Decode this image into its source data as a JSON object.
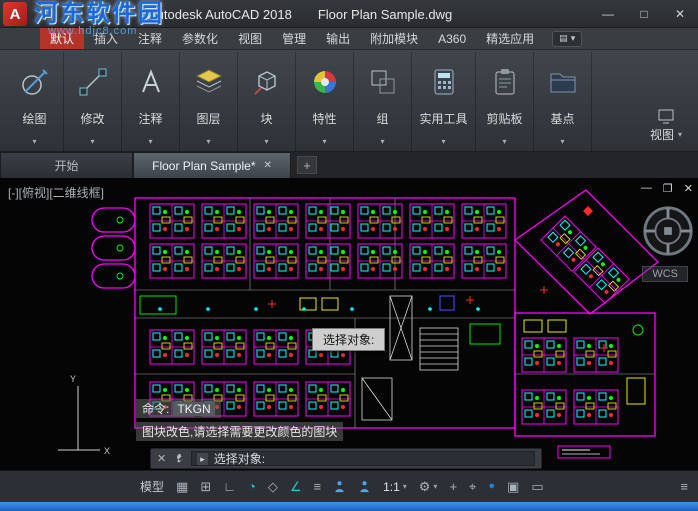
{
  "titlebar": {
    "app_title": "Autodesk AutoCAD 2018",
    "doc_title": "Floor Plan Sample.dwg",
    "logo_letter": "A",
    "minimize": "—",
    "maximize": "□",
    "close": "✕"
  },
  "watermark": {
    "title": "河东软件园",
    "url": "www.hdjc8.com"
  },
  "ribbon": {
    "tabs": [
      {
        "label": "默认",
        "active": true
      },
      {
        "label": "插入"
      },
      {
        "label": "注释"
      },
      {
        "label": "参数化"
      },
      {
        "label": "视图"
      },
      {
        "label": "管理"
      },
      {
        "label": "输出"
      },
      {
        "label": "附加模块"
      },
      {
        "label": "A360"
      },
      {
        "label": "精选应用"
      }
    ],
    "collapse_glyph": "▤",
    "dropdown": "▾",
    "panels": [
      {
        "label": "绘图"
      },
      {
        "label": "修改"
      },
      {
        "label": "注释"
      },
      {
        "label": "图层"
      },
      {
        "label": "块"
      },
      {
        "label": "特性"
      },
      {
        "label": "组"
      },
      {
        "label": "实用工具"
      },
      {
        "label": "剪贴板"
      },
      {
        "label": "基点"
      }
    ],
    "view_panel": "视图"
  },
  "file_tabs": {
    "start_label": "开始",
    "active_label": "Floor Plan Sample*",
    "close": "✕",
    "new": "+"
  },
  "canvas": {
    "viewport_label": "[-][俯视][二维线框]",
    "vp_min": "—",
    "vp_restore": "❐",
    "vp_close": "✕",
    "wcs": "WCS",
    "tooltip": "选择对象:",
    "history_prompt": "命令:",
    "history_command": "TKGN",
    "history_message": "图块改色,请选择需要更改颜色的图块",
    "ucs_x": "X",
    "ucs_y": "Y"
  },
  "command_line": {
    "close": "✕",
    "prompt_icon": "▸",
    "prompt": "选择对象:"
  },
  "statusbar": {
    "model_label": "模型",
    "scale_label": "1:1",
    "icons": {
      "grid": "▦",
      "snap": "⊞",
      "ortho": "∟",
      "polar": "◔",
      "isodraft": "◇",
      "otrack": "∠",
      "lineweight": "≡",
      "gear": "⚙",
      "plus": "+",
      "tracking": "⌖",
      "badge": "●",
      "isolate": "▣",
      "cleanscreen": "▭",
      "menu": "≡",
      "dropdown": "▾"
    }
  },
  "colors": {
    "active_tab_red": "#b5342a",
    "taskbar_blue": "#1f66c0",
    "plan_magenta": "#ff00ff",
    "plan_cyan": "#00ffff",
    "plan_green": "#00ff00",
    "plan_yellow": "#ffff00",
    "plan_red": "#ff2a2a",
    "status_teal": "#27c4d4",
    "status_blue": "#1e7fd6"
  }
}
